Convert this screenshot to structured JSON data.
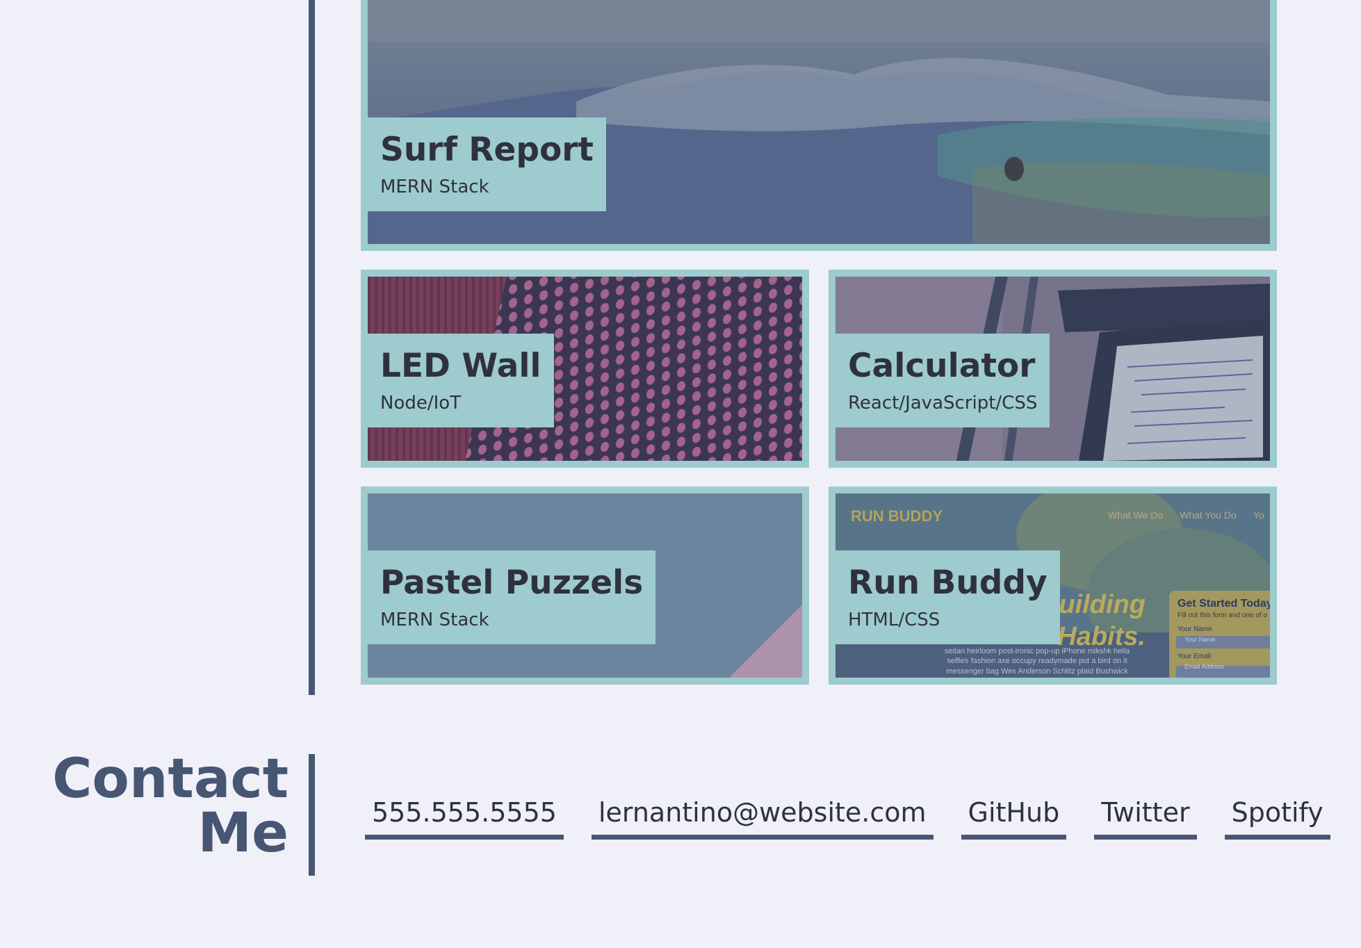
{
  "projects": [
    {
      "id": "surf",
      "title": "Surf Report",
      "stack": "MERN Stack"
    },
    {
      "id": "led",
      "title": "LED Wall",
      "stack": "Node/IoT"
    },
    {
      "id": "calc",
      "title": "Calculator",
      "stack": "React/JavaScript/CSS"
    },
    {
      "id": "pastel",
      "title": "Pastel Puzzels",
      "stack": "MERN Stack"
    },
    {
      "id": "run",
      "title": "Run Buddy",
      "stack": "HTML/CSS",
      "screenshot_text": {
        "brand": "RUN BUDDY",
        "nav": [
          "What We Do",
          "What You Do",
          "Yo"
        ],
        "hero": [
          "Building",
          "Habits."
        ],
        "form_title": "Get Started Today",
        "form_sub": "Fill out this form and one of o",
        "name_label": "Your Name",
        "name_placeholder": "Your Name",
        "email_label": "Your Email",
        "email_placeholder": "Email Address",
        "body": [
          "seitan heirloom post-ironic pop-up iPhone mikshk hella",
          "selfies fashion axe occupy readymade put a bird on it",
          "messenger bag Wes Anderson Schlitz plaid Bushwick"
        ]
      }
    }
  ],
  "contact": {
    "title_line1": "Contact",
    "title_line2": "Me",
    "links": [
      "555.555.5555",
      "lernantino@website.com",
      "GitHub",
      "Twitter",
      "Spotify"
    ]
  },
  "colors": {
    "background": "#eff0f8",
    "accent": "#475672",
    "card_border": "#9ecbcd",
    "text": "#2f3140"
  }
}
